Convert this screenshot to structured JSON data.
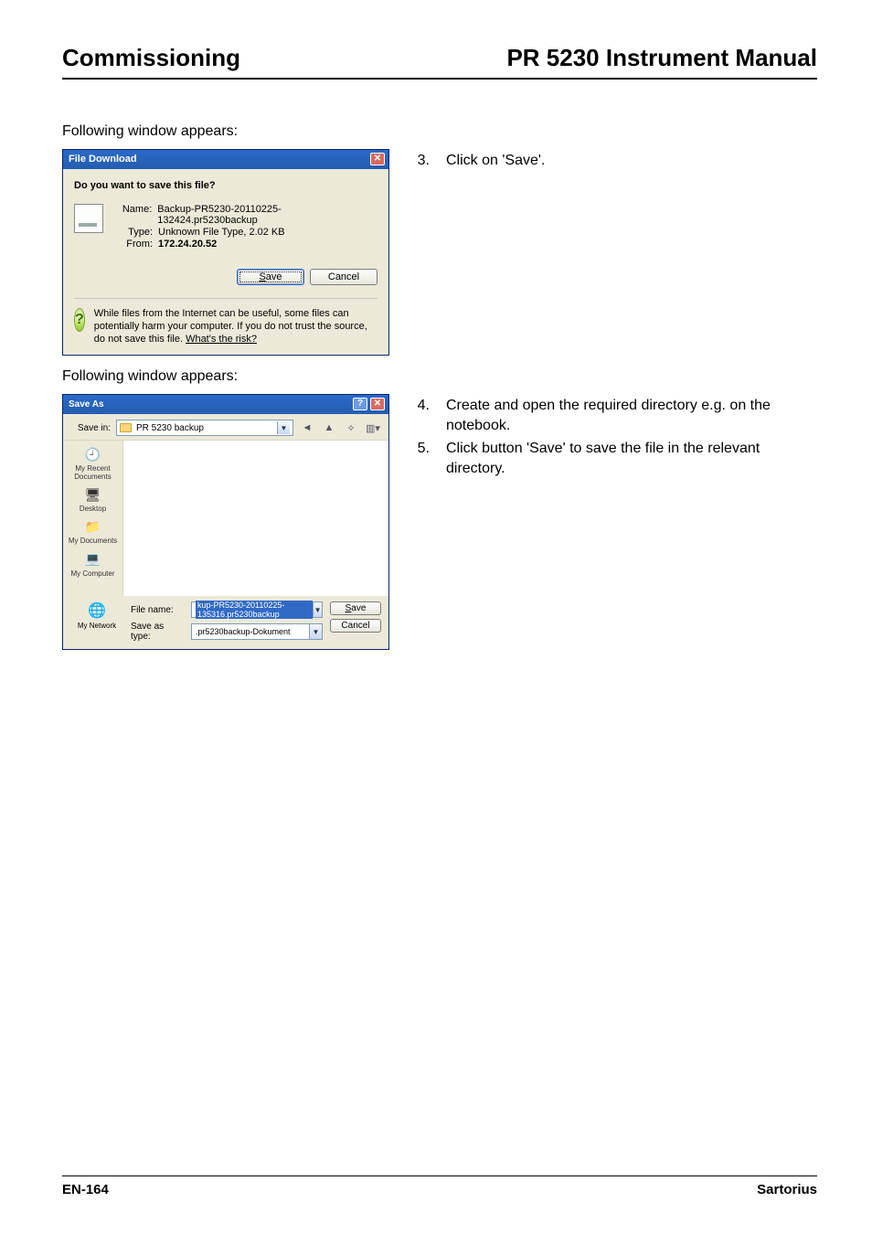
{
  "header": {
    "left": "Commissioning",
    "right": "PR 5230 Instrument Manual"
  },
  "intro1": "Following window appears:",
  "step3": "Click on 'Save'.",
  "intro2": "Following window appears:",
  "step4": "Create and open the required directory e.g. on the notebook.",
  "step5": "Click button 'Save' to save the file in the relevant directory.",
  "footer": {
    "left": "EN-164",
    "right": "Sartorius"
  },
  "dlg1": {
    "title": "File Download",
    "question": "Do you want to save this file?",
    "name_k": "Name:",
    "name_v": "Backup-PR5230-20110225-132424.pr5230backup",
    "type_k": "Type:",
    "type_v": "Unknown File Type, 2.02 KB",
    "from_k": "From:",
    "from_v": "172.24.20.52",
    "save_s": "S",
    "save_rest": "ave",
    "cancel": "Cancel",
    "warn_before": "While files from the Internet can be useful, some files can potentially harm your computer. If you do not trust the source, do not save this file. ",
    "warn_link": "What's the risk?",
    "close": "✕",
    "qmark": "?"
  },
  "dlg2": {
    "title": "Save As",
    "help": "?",
    "close": "✕",
    "savein_lbl": "Save in:",
    "savein_val": "PR 5230 backup",
    "tb_back": "◄",
    "tb_up": "▲",
    "tb_new": "✧",
    "tb_view": "▥▾",
    "place_recent": "My Recent\nDocuments",
    "place_desktop": "Desktop",
    "place_docs": "My Documents",
    "place_comp": "My Computer",
    "place_net": "My Network",
    "filename_lbl": "File name:",
    "filename_val": "kup-PR5230-20110225-135316.pr5230backup",
    "savetype_lbl": "Save as type:",
    "savetype_val": ".pr5230backup-Dokument",
    "save_s": "S",
    "save_rest": "ave",
    "cancel": "Cancel"
  }
}
